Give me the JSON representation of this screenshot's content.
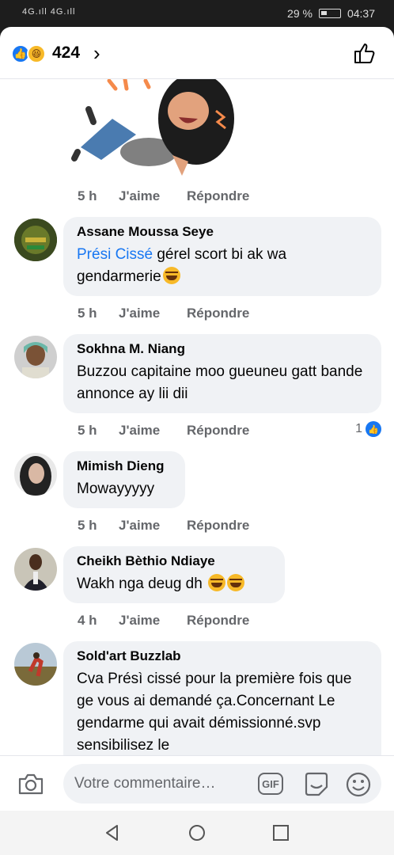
{
  "status_bar": {
    "signal": "4G.ıll 4G.ıll",
    "battery_text": "29 %",
    "time": "04:37"
  },
  "reactions": {
    "count": "424",
    "types": [
      "like-icon",
      "haha-icon"
    ]
  },
  "comments": [
    {
      "name": "",
      "time": "5 h",
      "like_label": "J'aime",
      "reply_label": "Répondre",
      "sticker": "laughing-woman-sticker"
    },
    {
      "name": "Assane Moussa Seye",
      "mention": "Président Cissé",
      "mention_display": "Prési Cissé",
      "text": " gérel scort bi ak wa gendarmerie",
      "time": "5 h",
      "like_label": "J'aime",
      "reply_label": "Répondre"
    },
    {
      "name": "Sokhna M. Niang",
      "text": "Buzzou capitaine moo gueuneu gatt bande annonce ay lii dii",
      "time": "5 h",
      "like_label": "J'aime",
      "reply_label": "Répondre",
      "reactions": "1"
    },
    {
      "name": "Mimish Dieng",
      "text": "Mowayyyyy",
      "time": "5 h",
      "like_label": "J'aime",
      "reply_label": "Répondre"
    },
    {
      "name": "Cheikh Bèthio Ndiaye",
      "text": "Wakh nga deug dh ",
      "time": "4 h",
      "like_label": "J'aime",
      "reply_label": "Répondre"
    },
    {
      "name": "Sold'art Buzzlab",
      "text": "Cva Présì cissé  pour la première fois que ge vous ai demandé ça.Concernant Le gendarme qui avait démissionné.svp sensibilisez le"
    }
  ],
  "composer": {
    "placeholder": "Votre commentaire…",
    "gif_label": "GIF"
  },
  "colors": {
    "accent": "#1877f2",
    "bubble": "#f0f2f5",
    "meta": "#65676b"
  }
}
